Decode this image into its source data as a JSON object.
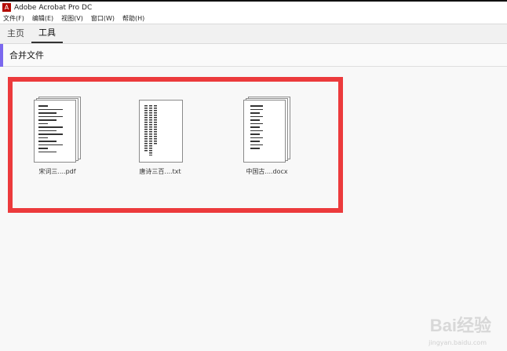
{
  "window": {
    "title": "Adobe Acrobat Pro DC",
    "icon": "acrobat-icon"
  },
  "menu": [
    "文件(F)",
    "编辑(E)",
    "视图(V)",
    "窗口(W)",
    "帮助(H)"
  ],
  "tabs": [
    {
      "label": "主页",
      "active": false
    },
    {
      "label": "工具",
      "active": true
    }
  ],
  "tool": {
    "title": "合并文件",
    "accent_color": "#7b68ee"
  },
  "files": [
    {
      "label": "宋词三....pdf",
      "type": "pdf"
    },
    {
      "label": "唐诗三百....txt",
      "type": "txt"
    },
    {
      "label": "中国古....docx",
      "type": "docx"
    }
  ],
  "highlight_color": "#ec3a3c",
  "watermark": {
    "text": "Bai经验",
    "sub": "jingyan.baidu.com"
  }
}
